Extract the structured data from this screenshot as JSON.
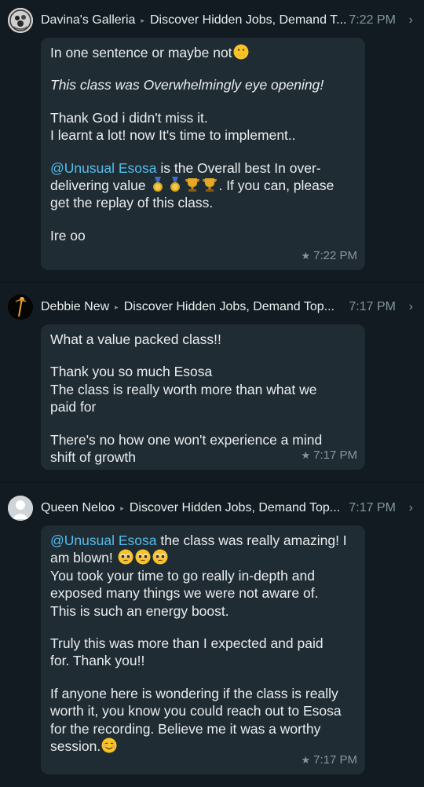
{
  "messages": [
    {
      "sender": "Davina's Galleria",
      "group": "Discover Hidden Jobs, Demand T...",
      "time": "7:22 PM",
      "body": {
        "line1": "In one sentence or maybe not",
        "line2": "This class was Overwhelmingly eye opening!",
        "line3": "Thank God i didn't miss it.",
        "line4": "I learnt a lot!  now It's time to implement..",
        "mention": "@Unusual Esosa",
        "line5_after_mention": " is the Overall best In over-",
        "line6_start": "delivering value ",
        "line6_end": ". If you can, please",
        "line7": "get the replay of this class.",
        "line8": "Ire oo"
      },
      "footer_time": "7:22 PM"
    },
    {
      "sender": "Debbie New",
      "group": "Discover Hidden Jobs, Demand Top...",
      "time": "7:17 PM",
      "body": {
        "line1": "What a value packed class!!",
        "line2": "Thank you so much Esosa",
        "line3": "The class is really worth more than what we",
        "line4": "paid for",
        "line5": "There's no how one won't experience a mind",
        "line6": "shift of growth"
      },
      "footer_time": "7:17 PM"
    },
    {
      "sender": "Queen Neloo",
      "group": "Discover Hidden Jobs, Demand Top...",
      "time": "7:17 PM",
      "body": {
        "mention": "@Unusual Esosa",
        "line1_after_mention": " the class was really amazing! I",
        "line2": "am blown! ",
        "line3": "You took your time to go really in-depth and",
        "line4": "exposed many things we were not aware of.",
        "line5": "This is such an energy boost.",
        "line6": "Truly  this was more than I expected and paid",
        "line7": "for. Thank you!!",
        "line8": "If anyone here is wondering if the class is really",
        "line9": "worth it, you know you could reach out to Esosa",
        "line10": "for the recording. Believe me it was a worthy",
        "line11": "session."
      },
      "footer_time": "7:17 PM"
    }
  ],
  "icons": {
    "separator": "▸",
    "chevron": "›",
    "star": "★"
  },
  "colors": {
    "background": "#111b21",
    "bubble": "#202c33",
    "mention": "#53bdeb",
    "meta": "#8696a0",
    "text": "#e9edef"
  }
}
